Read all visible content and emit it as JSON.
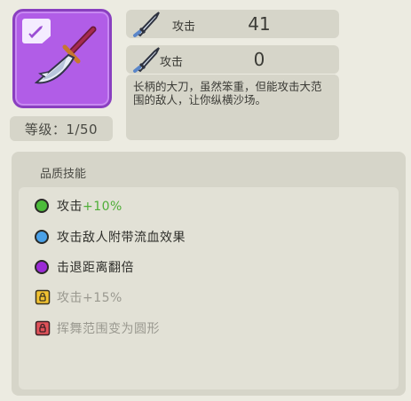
{
  "weapon": {
    "icon": "glaive-weapon-icon",
    "badge_icon": "sword-badge-icon",
    "card_color": "#b15de7"
  },
  "level": {
    "label": "等级：1/50"
  },
  "stats": [
    {
      "label": "攻击",
      "value": "41",
      "icon": "sword-icon"
    },
    {
      "label": "攻击",
      "value": "0",
      "icon": "sword-icon"
    }
  ],
  "description": "长柄的大刀，虽然笨重，但能攻击大范围的敌人，让你纵横沙场。",
  "skills": {
    "title": "品质技能",
    "items": [
      {
        "prefix": "攻击",
        "bonus": "+10%",
        "text": "",
        "color": "#4cbc3a",
        "locked": false
      },
      {
        "prefix": "",
        "bonus": "",
        "text": "攻击敌人附带流血效果",
        "color": "#4aa1e8",
        "locked": false
      },
      {
        "prefix": "",
        "bonus": "",
        "text": "击退距离翻倍",
        "color": "#9b2bd6",
        "locked": false
      },
      {
        "prefix": "",
        "bonus": "",
        "text": "攻击+15%",
        "color": "#f1c232",
        "locked": true
      },
      {
        "prefix": "",
        "bonus": "",
        "text": "挥舞范围变为圆形",
        "color": "#e0525a",
        "locked": true
      }
    ]
  }
}
